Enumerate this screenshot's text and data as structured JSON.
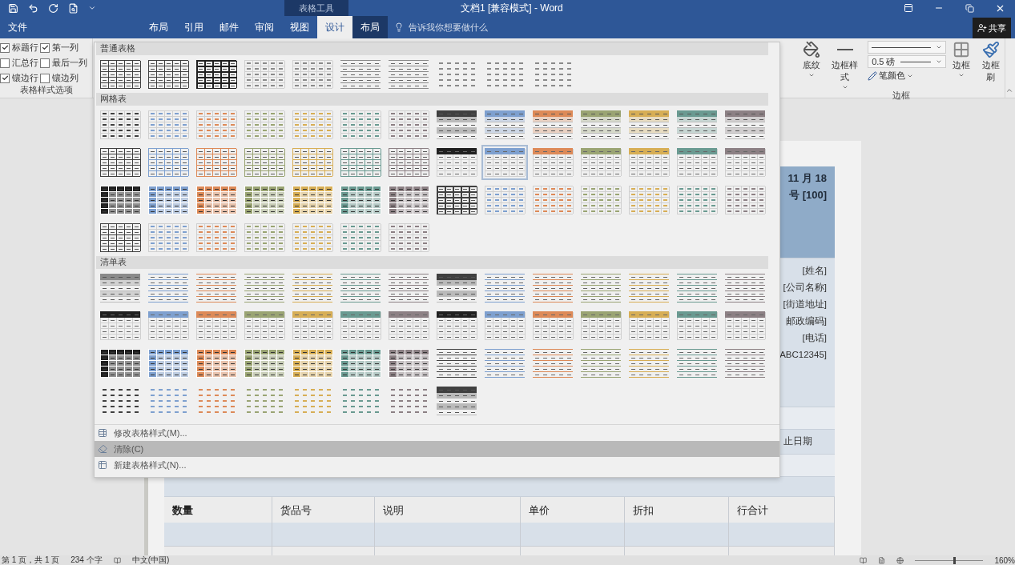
{
  "title_bar": {
    "title": "文档1 [兼容模式] - Word",
    "context_label": "表格工具"
  },
  "tabs": [
    {
      "label": "文件",
      "selected": false,
      "contextual": false
    },
    {
      "label": "布局",
      "selected": false,
      "contextual": false
    },
    {
      "label": "引用",
      "selected": false,
      "contextual": false
    },
    {
      "label": "邮件",
      "selected": false,
      "contextual": false
    },
    {
      "label": "审阅",
      "selected": false,
      "contextual": false
    },
    {
      "label": "视图",
      "selected": false,
      "contextual": false
    },
    {
      "label": "设计",
      "selected": true,
      "contextual": true
    },
    {
      "label": "布局",
      "selected": false,
      "contextual": true
    }
  ],
  "tell_me": {
    "placeholder": "告诉我你想要做什么"
  },
  "share_button": "共享",
  "style_options": {
    "group_label": "表格样式选项",
    "items": [
      {
        "label": "标题行",
        "checked": true
      },
      {
        "label": "第一列",
        "checked": true
      },
      {
        "label": "汇总行",
        "checked": false
      },
      {
        "label": "最后一列",
        "checked": false
      },
      {
        "label": "镶边行",
        "checked": true
      },
      {
        "label": "镶边列",
        "checked": false
      }
    ]
  },
  "borders": {
    "shading_label": "底纹",
    "border_styles_label": "边框样式",
    "pen_weight": "0.5 磅",
    "pen_color_label": "笔颜色",
    "borders_label": "边框",
    "border_painter_label": "边框刷",
    "group_label": "边框"
  },
  "gallery": {
    "sections": [
      {
        "title": "普通表格",
        "rows": [
          [
            {
              "kind": "grid",
              "color": "#404040",
              "selected": false
            },
            {
              "kind": "grid",
              "color": "#404040",
              "selected": false
            },
            {
              "kind": "bold",
              "color": "#202020",
              "selected": false
            },
            {
              "kind": "light",
              "color": "#8a8a8a",
              "selected": false
            },
            {
              "kind": "light",
              "color": "#8a8a8a",
              "selected": false
            },
            {
              "kind": "lines",
              "color": "#8a8a8a",
              "selected": false
            },
            {
              "kind": "lines",
              "color": "#8a8a8a",
              "selected": false
            },
            {
              "kind": "plain",
              "color": "#8a8a8a",
              "selected": false
            },
            {
              "kind": "plain",
              "color": "#8a8a8a",
              "selected": false
            },
            {
              "kind": "plain",
              "color": "#8a8a8a",
              "selected": false
            }
          ]
        ]
      },
      {
        "title": "网格表",
        "rows": [
          [
            {
              "kind": "light",
              "color": "#404040",
              "selected": false
            },
            {
              "kind": "light",
              "color": "#7ea0cf",
              "selected": false
            },
            {
              "kind": "light",
              "color": "#dd8a58",
              "selected": false
            },
            {
              "kind": "light",
              "color": "#9aa473",
              "selected": false
            },
            {
              "kind": "light",
              "color": "#d7ae55",
              "selected": false
            },
            {
              "kind": "light",
              "color": "#6a9a91",
              "selected": false
            },
            {
              "kind": "light",
              "color": "#8c8084",
              "selected": false
            },
            {
              "kind": "banded",
              "color": "#404040",
              "selected": false
            },
            {
              "kind": "banded",
              "color": "#7ea0cf",
              "selected": false
            },
            {
              "kind": "banded",
              "color": "#dd8a58",
              "selected": false
            },
            {
              "kind": "banded",
              "color": "#9aa473",
              "selected": false
            },
            {
              "kind": "banded",
              "color": "#d7ae55",
              "selected": false
            },
            {
              "kind": "banded",
              "color": "#6a9a91",
              "selected": false
            },
            {
              "kind": "banded",
              "color": "#8c8084",
              "selected": false
            }
          ],
          [
            {
              "kind": "grid",
              "color": "#404040",
              "selected": false
            },
            {
              "kind": "grid",
              "color": "#7ea0cf",
              "selected": false
            },
            {
              "kind": "grid",
              "color": "#dd8a58",
              "selected": false
            },
            {
              "kind": "grid",
              "color": "#9aa473",
              "selected": false
            },
            {
              "kind": "grid",
              "color": "#d7ae55",
              "selected": false
            },
            {
              "kind": "grid",
              "color": "#6a9a91",
              "selected": false
            },
            {
              "kind": "grid",
              "color": "#8c8084",
              "selected": false
            },
            {
              "kind": "header",
              "color": "#202020",
              "selected": false
            },
            {
              "kind": "header",
              "color": "#7ea0cf",
              "selected": true
            },
            {
              "kind": "header",
              "color": "#dd8a58",
              "selected": false
            },
            {
              "kind": "header",
              "color": "#9aa473",
              "selected": false
            },
            {
              "kind": "header",
              "color": "#d7ae55",
              "selected": false
            },
            {
              "kind": "header",
              "color": "#6a9a91",
              "selected": false
            },
            {
              "kind": "header",
              "color": "#8c8084",
              "selected": false
            }
          ],
          [
            {
              "kind": "filled",
              "color": "#202020",
              "selected": false
            },
            {
              "kind": "filled",
              "color": "#7ea0cf",
              "selected": false
            },
            {
              "kind": "filled",
              "color": "#dd8a58",
              "selected": false
            },
            {
              "kind": "filled",
              "color": "#9aa473",
              "selected": false
            },
            {
              "kind": "filled",
              "color": "#d7ae55",
              "selected": false
            },
            {
              "kind": "filled",
              "color": "#6a9a91",
              "selected": false
            },
            {
              "kind": "filled",
              "color": "#8c8084",
              "selected": false
            },
            {
              "kind": "bold",
              "color": "#404040",
              "selected": false
            },
            {
              "kind": "light",
              "color": "#7ea0cf",
              "selected": false
            },
            {
              "kind": "light",
              "color": "#dd8a58",
              "selected": false
            },
            {
              "kind": "light",
              "color": "#9aa473",
              "selected": false
            },
            {
              "kind": "light",
              "color": "#d7ae55",
              "selected": false
            },
            {
              "kind": "light",
              "color": "#6a9a91",
              "selected": false
            },
            {
              "kind": "light",
              "color": "#8c8084",
              "selected": false
            }
          ],
          [
            {
              "kind": "grid",
              "color": "#404040",
              "selected": false
            },
            {
              "kind": "light",
              "color": "#7ea0cf",
              "selected": false
            },
            {
              "kind": "light",
              "color": "#dd8a58",
              "selected": false
            },
            {
              "kind": "light",
              "color": "#9aa473",
              "selected": false
            },
            {
              "kind": "light",
              "color": "#d7ae55",
              "selected": false
            },
            {
              "kind": "light",
              "color": "#6a9a91",
              "selected": false
            },
            {
              "kind": "light",
              "color": "#8c8084",
              "selected": false
            }
          ]
        ]
      },
      {
        "title": "清单表",
        "rows": [
          [
            {
              "kind": "banded",
              "color": "#8a8a8a",
              "selected": false
            },
            {
              "kind": "lines",
              "color": "#7ea0cf",
              "selected": false
            },
            {
              "kind": "lines",
              "color": "#dd8a58",
              "selected": false
            },
            {
              "kind": "lines",
              "color": "#9aa473",
              "selected": false
            },
            {
              "kind": "lines",
              "color": "#d7ae55",
              "selected": false
            },
            {
              "kind": "lines",
              "color": "#6a9a91",
              "selected": false
            },
            {
              "kind": "lines",
              "color": "#8c8084",
              "selected": false
            },
            {
              "kind": "banded",
              "color": "#404040",
              "selected": false
            },
            {
              "kind": "lines",
              "color": "#7ea0cf",
              "selected": false
            },
            {
              "kind": "lines",
              "color": "#dd8a58",
              "selected": false
            },
            {
              "kind": "lines",
              "color": "#9aa473",
              "selected": false
            },
            {
              "kind": "lines",
              "color": "#d7ae55",
              "selected": false
            },
            {
              "kind": "lines",
              "color": "#6a9a91",
              "selected": false
            },
            {
              "kind": "lines",
              "color": "#8c8084",
              "selected": false
            }
          ],
          [
            {
              "kind": "header",
              "color": "#202020",
              "selected": false
            },
            {
              "kind": "header",
              "color": "#7ea0cf",
              "selected": false
            },
            {
              "kind": "header",
              "color": "#dd8a58",
              "selected": false
            },
            {
              "kind": "header",
              "color": "#9aa473",
              "selected": false
            },
            {
              "kind": "header",
              "color": "#d7ae55",
              "selected": false
            },
            {
              "kind": "header",
              "color": "#6a9a91",
              "selected": false
            },
            {
              "kind": "header",
              "color": "#8c8084",
              "selected": false
            },
            {
              "kind": "header",
              "color": "#202020",
              "selected": false
            },
            {
              "kind": "header",
              "color": "#7ea0cf",
              "selected": false
            },
            {
              "kind": "header",
              "color": "#dd8a58",
              "selected": false
            },
            {
              "kind": "header",
              "color": "#9aa473",
              "selected": false
            },
            {
              "kind": "header",
              "color": "#d7ae55",
              "selected": false
            },
            {
              "kind": "header",
              "color": "#6a9a91",
              "selected": false
            },
            {
              "kind": "header",
              "color": "#8c8084",
              "selected": false
            }
          ],
          [
            {
              "kind": "filled",
              "color": "#202020",
              "selected": false
            },
            {
              "kind": "filled",
              "color": "#7ea0cf",
              "selected": false
            },
            {
              "kind": "filled",
              "color": "#dd8a58",
              "selected": false
            },
            {
              "kind": "filled",
              "color": "#9aa473",
              "selected": false
            },
            {
              "kind": "filled",
              "color": "#d7ae55",
              "selected": false
            },
            {
              "kind": "filled",
              "color": "#6a9a91",
              "selected": false
            },
            {
              "kind": "filled",
              "color": "#8c8084",
              "selected": false
            },
            {
              "kind": "lines",
              "color": "#404040",
              "selected": false
            },
            {
              "kind": "lines",
              "color": "#7ea0cf",
              "selected": false
            },
            {
              "kind": "lines",
              "color": "#dd8a58",
              "selected": false
            },
            {
              "kind": "lines",
              "color": "#9aa473",
              "selected": false
            },
            {
              "kind": "lines",
              "color": "#d7ae55",
              "selected": false
            },
            {
              "kind": "lines",
              "color": "#6a9a91",
              "selected": false
            },
            {
              "kind": "lines",
              "color": "#8c8084",
              "selected": false
            }
          ],
          [
            {
              "kind": "plain",
              "color": "#404040",
              "selected": false
            },
            {
              "kind": "plain",
              "color": "#7ea0cf",
              "selected": false
            },
            {
              "kind": "plain",
              "color": "#dd8a58",
              "selected": false
            },
            {
              "kind": "plain",
              "color": "#9aa473",
              "selected": false
            },
            {
              "kind": "plain",
              "color": "#d7ae55",
              "selected": false
            },
            {
              "kind": "plain",
              "color": "#6a9a91",
              "selected": false
            },
            {
              "kind": "plain",
              "color": "#8c8084",
              "selected": false
            },
            {
              "kind": "banded",
              "color": "#404040",
              "selected": false
            }
          ]
        ]
      }
    ],
    "commands": [
      {
        "label": "修改表格样式(M)...",
        "highlighted": false
      },
      {
        "label": "清除(C)",
        "highlighted": true
      },
      {
        "label": "新建表格样式(N)...",
        "highlighted": false
      }
    ]
  },
  "document": {
    "header_lines": [
      "11 月 18",
      "号 [100]"
    ],
    "address_lines": [
      "[姓名]",
      "[公司名称]",
      "[街道地址]",
      "邮政编码]",
      "[电话]",
      "ABC12345]"
    ],
    "date_label": "止日期",
    "columns": [
      {
        "label": "数量",
        "bold": true
      },
      {
        "label": "货品号",
        "bold": false
      },
      {
        "label": "说明",
        "bold": false
      },
      {
        "label": "单价",
        "bold": false
      },
      {
        "label": "折扣",
        "bold": false
      },
      {
        "label": "行合计",
        "bold": false
      }
    ]
  },
  "status_bar": {
    "page": "第 1 页，共 1 页",
    "words": "234 个字",
    "language": "中文(中国)",
    "zoom": {
      "level": 0.56,
      "reading": "160%"
    }
  }
}
